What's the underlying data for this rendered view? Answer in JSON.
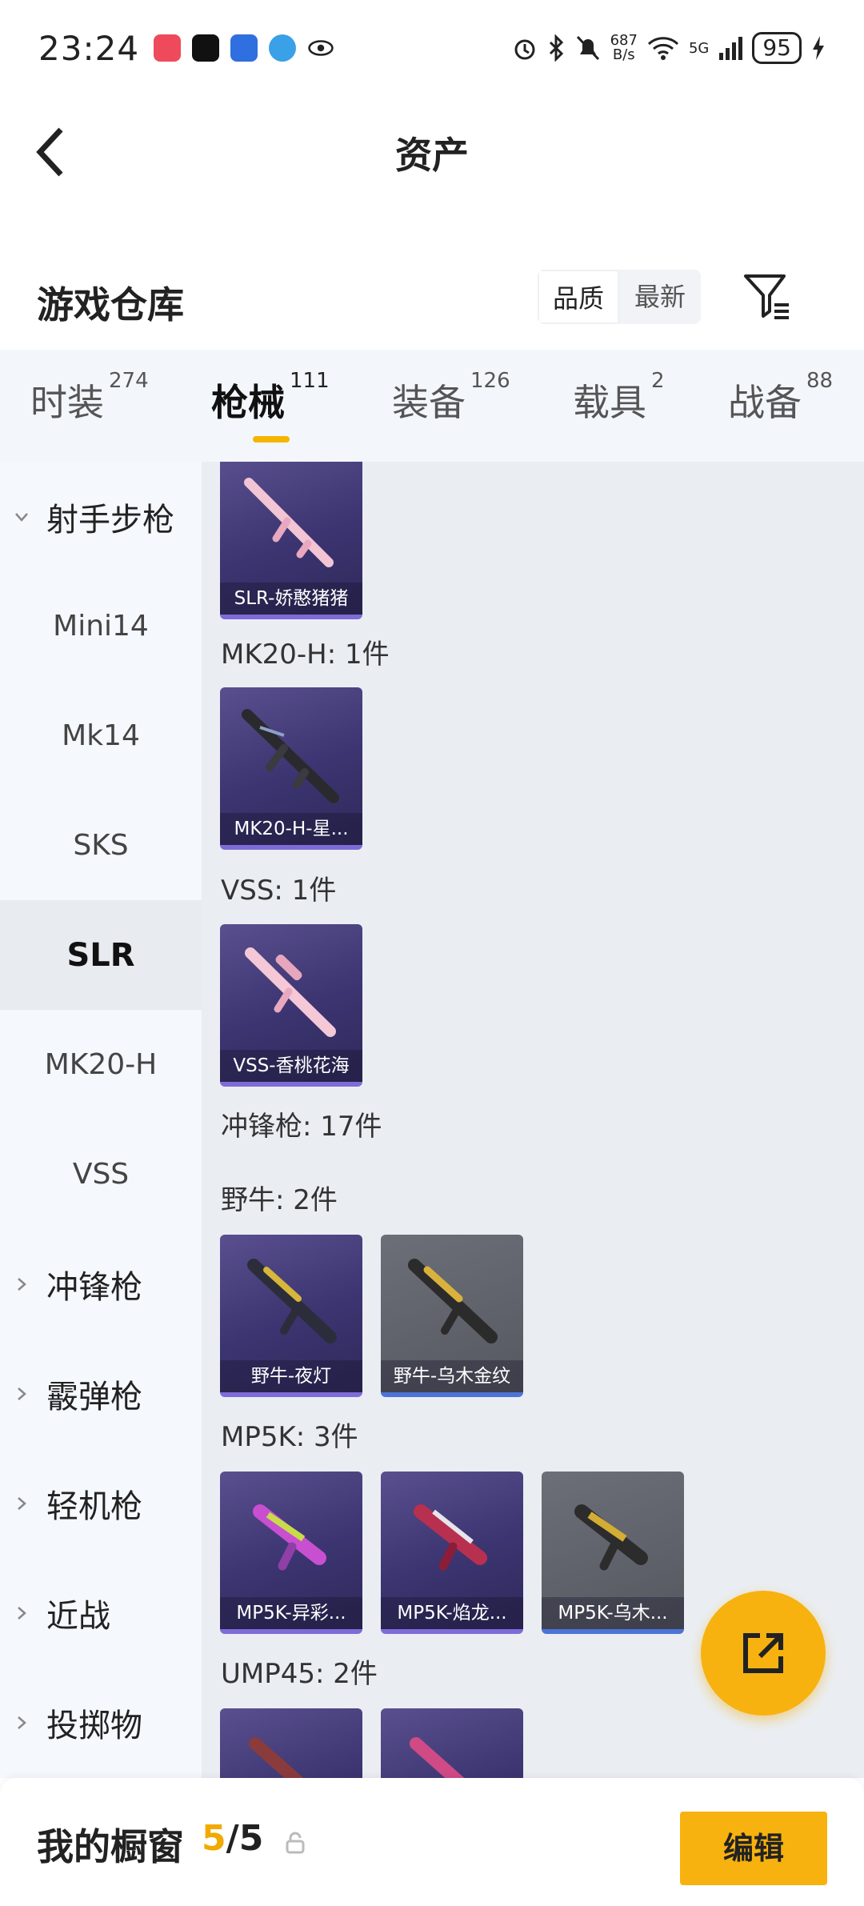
{
  "status_bar": {
    "time": "23:24",
    "net_speed_value": "687",
    "net_speed_unit": "B/s",
    "signal_label": "5G",
    "battery": "95"
  },
  "header": {
    "title": "资产"
  },
  "warehouse": {
    "title": "游戏仓库",
    "sort_quality": "品质",
    "sort_latest": "最新"
  },
  "tabs": [
    {
      "label": "时装",
      "count": "274"
    },
    {
      "label": "枪械",
      "count": "111"
    },
    {
      "label": "装备",
      "count": "126"
    },
    {
      "label": "载具",
      "count": "2"
    },
    {
      "label": "战备",
      "count": "88"
    }
  ],
  "sidebar": {
    "items": [
      {
        "label": "射手步枪"
      },
      {
        "label": "Mini14"
      },
      {
        "label": "Mk14"
      },
      {
        "label": "SKS"
      },
      {
        "label": "SLR"
      },
      {
        "label": "MK20-H"
      },
      {
        "label": "VSS"
      },
      {
        "label": "冲锋枪"
      },
      {
        "label": "霰弹枪"
      },
      {
        "label": "轻机枪"
      },
      {
        "label": "近战"
      },
      {
        "label": "投掷物"
      }
    ]
  },
  "content": {
    "sections": [
      {
        "label": "MK20-H: 1件"
      },
      {
        "label": "VSS: 1件"
      },
      {
        "label": "冲锋枪: 17件"
      },
      {
        "label": "野牛: 2件"
      },
      {
        "label": "MP5K: 3件"
      },
      {
        "label": "UMP45: 2件"
      }
    ],
    "cards": [
      {
        "name": "SLR-娇憨猪猪"
      },
      {
        "name": "MK20-H-星..."
      },
      {
        "name": "VSS-香桃花海"
      },
      {
        "name": "野牛-夜灯"
      },
      {
        "name": "野牛-乌木金纹"
      },
      {
        "name": "MP5K-异彩..."
      },
      {
        "name": "MP5K-焰龙..."
      },
      {
        "name": "MP5K-乌木..."
      },
      {
        "name": ""
      },
      {
        "name": ""
      }
    ]
  },
  "bottom_bar": {
    "title": "我的橱窗",
    "current": "5",
    "separator": "/",
    "total": "5",
    "edit_label": "编辑"
  },
  "colors": {
    "accent": "#f7b20f",
    "card_purple": "#3b3470",
    "card_gray": "#5e6169"
  }
}
